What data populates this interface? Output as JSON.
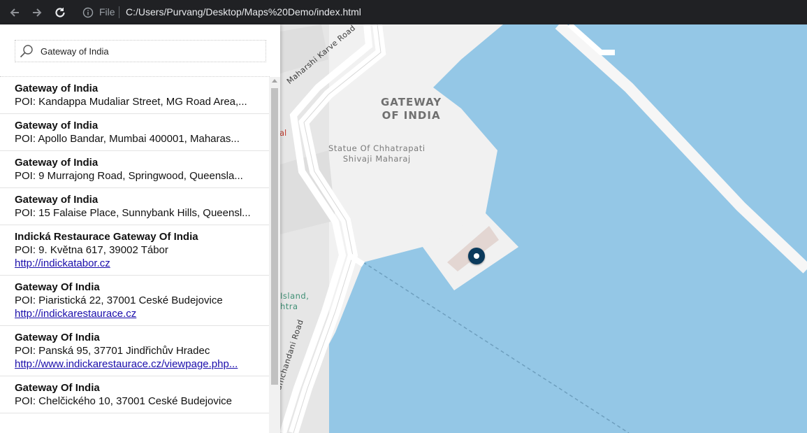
{
  "browser": {
    "file_label": "File",
    "url": "C:/Users/Purvang/Desktop/Maps%20Demo/index.html",
    "icons": [
      "back-arrow-icon",
      "forward-arrow-icon",
      "reload-icon",
      "info-icon"
    ]
  },
  "search": {
    "value": "Gateway of India",
    "icon": "search-icon"
  },
  "results": [
    {
      "title": "Gateway of India",
      "address": "POI: Kandappa Mudaliar Street, MG Road Area,...",
      "link": ""
    },
    {
      "title": "Gateway of India",
      "address": "POI: Apollo Bandar, Mumbai 400001, Maharas...",
      "link": ""
    },
    {
      "title": "Gateway of India",
      "address": "POI: 9 Murrajong Road, Springwood, Queensla...",
      "link": ""
    },
    {
      "title": "Gateway of India",
      "address": "POI: 15 Falaise Place, Sunnybank Hills, Queensl...",
      "link": ""
    },
    {
      "title": "Indická Restaurace Gateway Of India",
      "address": "POI: 9. Května 617, 39002 Tábor",
      "link": "http://indickatabor.cz"
    },
    {
      "title": "Gateway Of India",
      "address": "POI: Piaristická 22, 37001 Ceské Budejovice",
      "link": "http://indickarestaurace.cz"
    },
    {
      "title": "Gateway Of India",
      "address": "POI: Panská 95, 37701 Jindřichův Hradec",
      "link": "http://www.indickarestaurace.cz/viewpage.php..."
    },
    {
      "title": "Gateway Of India",
      "address": "POI: Chelčického 10, 37001 Ceské Budejovice",
      "link": ""
    }
  ],
  "map": {
    "labels": {
      "gateway_line1": "GATEWAY",
      "gateway_line2": "OF INDIA",
      "statue_line1": "Statue Of Chhatrapati",
      "statue_line2": "Shivaji Maharaj",
      "karve_road": "Maharshi Karve Road",
      "ramchandani_road": "amchandani Road",
      "island_line1": "Island,",
      "island_line2": "htra",
      "partial_red": "al"
    },
    "colors": {
      "water": "#94c7e6",
      "land": "#f1f1f1",
      "road": "#ffffff",
      "marker": "#0b3a5c"
    }
  }
}
